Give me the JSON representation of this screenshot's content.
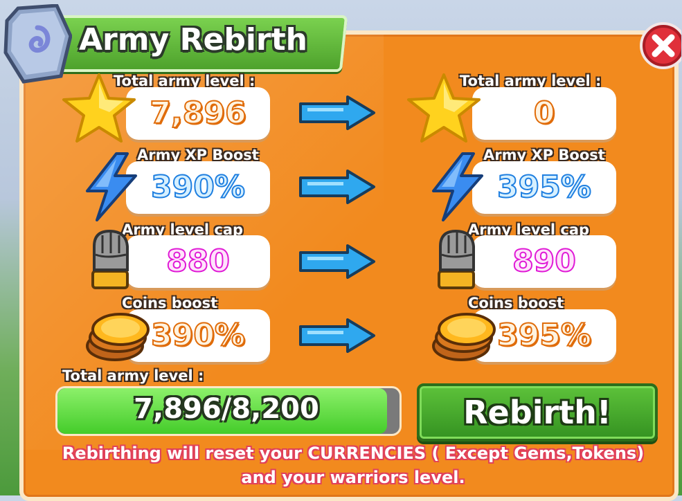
{
  "title": "Army Rebirth",
  "close_icon": "close-icon",
  "rows": [
    {
      "label": "Total army level :",
      "before": "7,896",
      "after": "0",
      "icon": "star-icon",
      "color": "#f5871d"
    },
    {
      "label": "Army XP Boost",
      "before": "390%",
      "after": "395%",
      "icon": "lightning-icon",
      "color": "#1f7fe0"
    },
    {
      "label": "Army level cap",
      "before": "880",
      "after": "890",
      "icon": "fist-icon",
      "color": "#e01ad6"
    },
    {
      "label": "Coins boost",
      "before": "390%",
      "after": "395%",
      "icon": "coins-icon",
      "color": "#f5871d"
    }
  ],
  "progress": {
    "label": "Total army level :",
    "text": "7,896/8,200",
    "current": 7896,
    "max": 8200
  },
  "rebirth_button": "Rebirth!",
  "warning": {
    "line1": "Rebirthing will reset your CURRENCIES ( Except Gems,Tokens)",
    "line2": "and your warriors level."
  },
  "colors": {
    "panel": "#f28a1e",
    "title_banner": "#4ea22c",
    "button": "#349221",
    "progress_fill": "#44cc2a",
    "close": "#e0303a"
  }
}
